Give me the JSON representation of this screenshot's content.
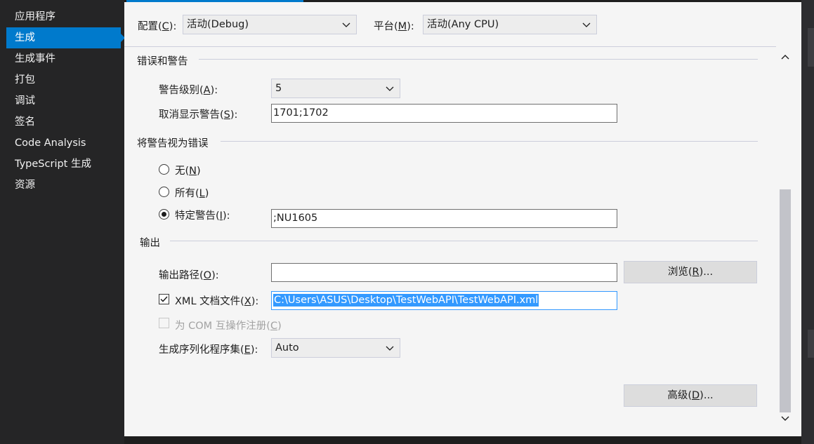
{
  "sidebar": {
    "items": [
      {
        "label": "应用程序",
        "active": false
      },
      {
        "label": "生成",
        "active": true
      },
      {
        "label": "生成事件",
        "active": false
      },
      {
        "label": "打包",
        "active": false
      },
      {
        "label": "调试",
        "active": false
      },
      {
        "label": "签名",
        "active": false
      },
      {
        "label": "Code Analysis",
        "active": false
      },
      {
        "label": "TypeScript 生成",
        "active": false
      },
      {
        "label": "资源",
        "active": false
      }
    ]
  },
  "header": {
    "config": {
      "label_pre": "配置(",
      "key": "C",
      "label_post": "):",
      "value": "活动(Debug)"
    },
    "platform": {
      "label_pre": "平台(",
      "key": "M",
      "label_post": "):",
      "value": "活动(Any CPU)"
    }
  },
  "errors_warnings": {
    "title": "错误和警告",
    "warning_level": {
      "label_pre": "警告级别(",
      "key": "A",
      "label_post": "):",
      "value": "5"
    },
    "suppress": {
      "label_pre": "取消显示警告(",
      "key": "S",
      "label_post": "):",
      "value": "1701;1702"
    }
  },
  "treat_as_errors": {
    "title": "将警告视为错误",
    "none": {
      "label_pre": "无(",
      "key": "N",
      "label_post": ")",
      "checked": false
    },
    "all": {
      "label_pre": "所有(",
      "key": "L",
      "label_post": ")",
      "checked": false
    },
    "specific": {
      "label_pre": "特定警告(",
      "key": "I",
      "label_post": "):",
      "checked": true,
      "value": ";NU1605"
    }
  },
  "output": {
    "title": "输出",
    "path": {
      "label_pre": "输出路径(",
      "key": "O",
      "label_post": "):",
      "value": ""
    },
    "browse": {
      "label_pre": "浏览(",
      "key": "R",
      "label_post": ")..."
    },
    "xml": {
      "label_pre": "XML 文档文件(",
      "key": "X",
      "label_post": "):",
      "checked": true,
      "value": "C:\\Users\\ASUS\\Desktop\\TestWebAPI\\TestWebAPI.xml"
    },
    "com": {
      "label_pre": "为 COM 互操作注册(",
      "key": "C",
      "label_post": ")",
      "checked": false,
      "disabled": true
    },
    "serialization": {
      "label_pre": "生成序列化程序集(",
      "key": "E",
      "label_post": "):",
      "value": "Auto"
    },
    "advanced": {
      "label_pre": "高级(",
      "key": "D",
      "label_post": ")..."
    }
  },
  "icons": {
    "dropdown": "chevron-down-icon",
    "scroll_up": "chevron-up-icon",
    "scroll_down": "chevron-down-icon"
  },
  "colors": {
    "accent": "#007acc",
    "selection": "#3399ff",
    "panel": "#f5f5f5",
    "sidebar": "#252526"
  }
}
